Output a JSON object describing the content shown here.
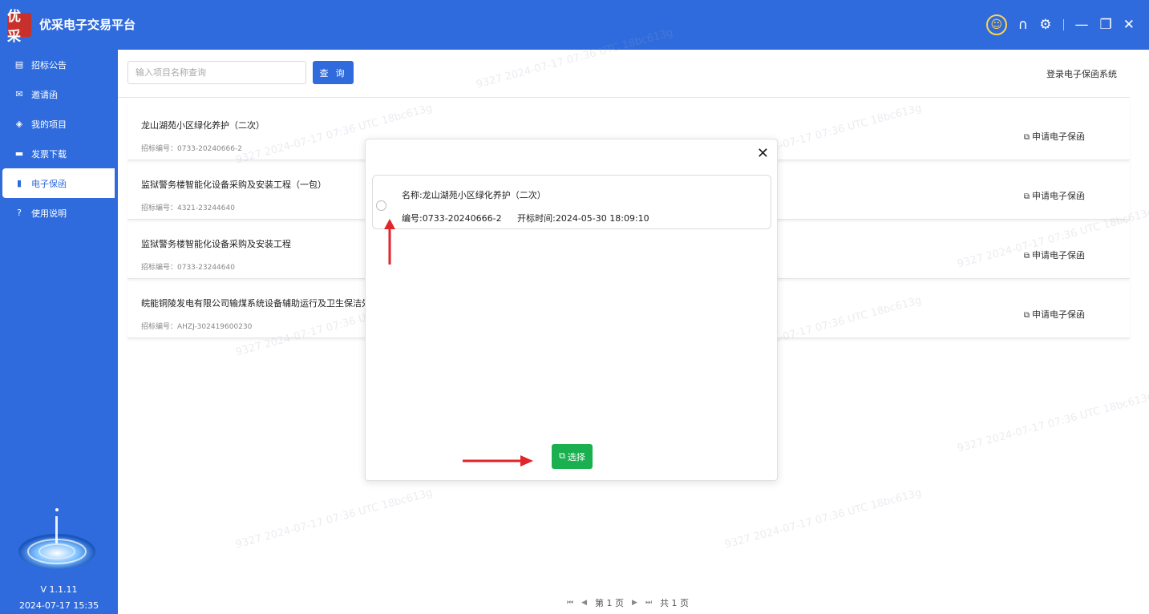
{
  "app": {
    "title": "优采电子交易平台",
    "logo_text": "优采"
  },
  "titlebar": {
    "avatar_icon": "user-avatar-icon",
    "headset_icon": "headset-icon",
    "settings_icon": "gear-icon",
    "minimize": "—",
    "restore": "❐",
    "close": "✕"
  },
  "sidebar": {
    "items": [
      {
        "label": "招标公告",
        "icon": "announcement-icon",
        "glyph": "▤"
      },
      {
        "label": "邀请函",
        "icon": "mail-icon",
        "glyph": "✉"
      },
      {
        "label": "我的项目",
        "icon": "layers-icon",
        "glyph": "◈"
      },
      {
        "label": "发票下载",
        "icon": "invoice-icon",
        "glyph": "▬"
      },
      {
        "label": "电子保函",
        "icon": "guarantee-icon",
        "glyph": "▮"
      },
      {
        "label": "使用说明",
        "icon": "help-icon",
        "glyph": "?"
      }
    ],
    "active_index": 4,
    "version": "V 1.1.11",
    "datetime": "2024-07-17 15:35"
  },
  "search": {
    "placeholder": "输入项目名称查询",
    "button_label": "查 询"
  },
  "top_link": "登录电子保函系统",
  "list": [
    {
      "title": "龙山湖苑小区绿化养护（二次）",
      "code": "招标编号：0733-20240666-2",
      "action": "申请电子保函"
    },
    {
      "title": "监狱警务楼智能化设备采购及安装工程（一包）",
      "code": "招标编号：4321-23244640",
      "action": "申请电子保函"
    },
    {
      "title": "监狱警务楼智能化设备采购及安装工程",
      "code": "招标编号：0733-23244640",
      "action": "申请电子保函"
    },
    {
      "title": "皖能铜陵发电有限公司输煤系统设备辅助运行及卫生保洁外委",
      "code": "招标编号：AHZJ-302419600230",
      "action": "申请电子保函"
    }
  ],
  "pager": {
    "first": "⏮",
    "prev": "◀",
    "current": "第 1 页",
    "next": "▶",
    "last": "⏭",
    "total": "共 1 页"
  },
  "modal": {
    "close": "✕",
    "option": {
      "name": "名称:龙山湖苑小区绿化养护（二次）",
      "code": "编号:0733-20240666-2",
      "open_time": "开标时间:2024-05-30 18:09:10"
    },
    "select_label": "选择"
  },
  "watermark": "9327 2024-07-17 07:36 UTC 18bc613g",
  "colors": {
    "brand": "#2f6bdc",
    "select_button": "#1aaf4f",
    "arrow": "#e0262b"
  }
}
